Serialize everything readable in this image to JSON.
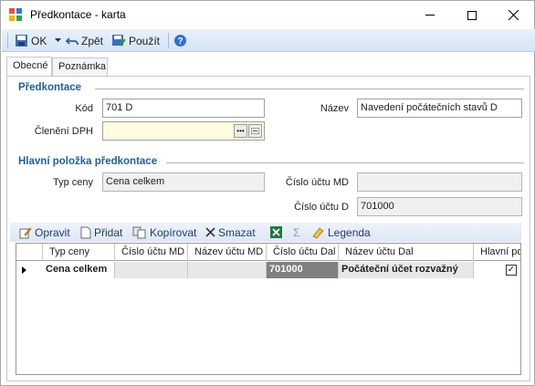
{
  "window": {
    "title": "Předkontace - karta"
  },
  "toolbar": {
    "ok": "OK",
    "back": "Zpět",
    "apply": "Použít"
  },
  "tabs": [
    "Obecné",
    "Poznámka"
  ],
  "section1": {
    "title": "Předkontace",
    "kod_label": "Kód",
    "kod_value": "701 D",
    "nazev_label": "Název",
    "nazev_value": "Navedení počátečních stavů D",
    "cleneni_label": "Členění DPH",
    "cleneni_value": ""
  },
  "section2": {
    "title": "Hlavní položka předkontace",
    "typ_label": "Typ ceny",
    "typ_value": "Cena celkem",
    "md_label": "Číslo účtu MD",
    "md_value": "",
    "d_label": "Číslo účtu D",
    "d_value": "701000"
  },
  "grid_toolbar": {
    "edit": "Opravit",
    "add": "Přidat",
    "copy": "Kopírovat",
    "delete": "Smazat",
    "legend": "Legenda",
    "sum": "Σ"
  },
  "grid": {
    "columns": [
      "Typ ceny",
      "Číslo účtu MD",
      "Název účtu MD",
      "Číslo účtu Dal",
      "Název účtu Dal",
      "Hlavní po"
    ],
    "rows": [
      {
        "typ": "Cena celkem",
        "md": "",
        "nazev_md": "",
        "dal": "701000",
        "nazev_dal": "Počáteční účet rozvažný",
        "hlavni": "✓"
      }
    ]
  }
}
